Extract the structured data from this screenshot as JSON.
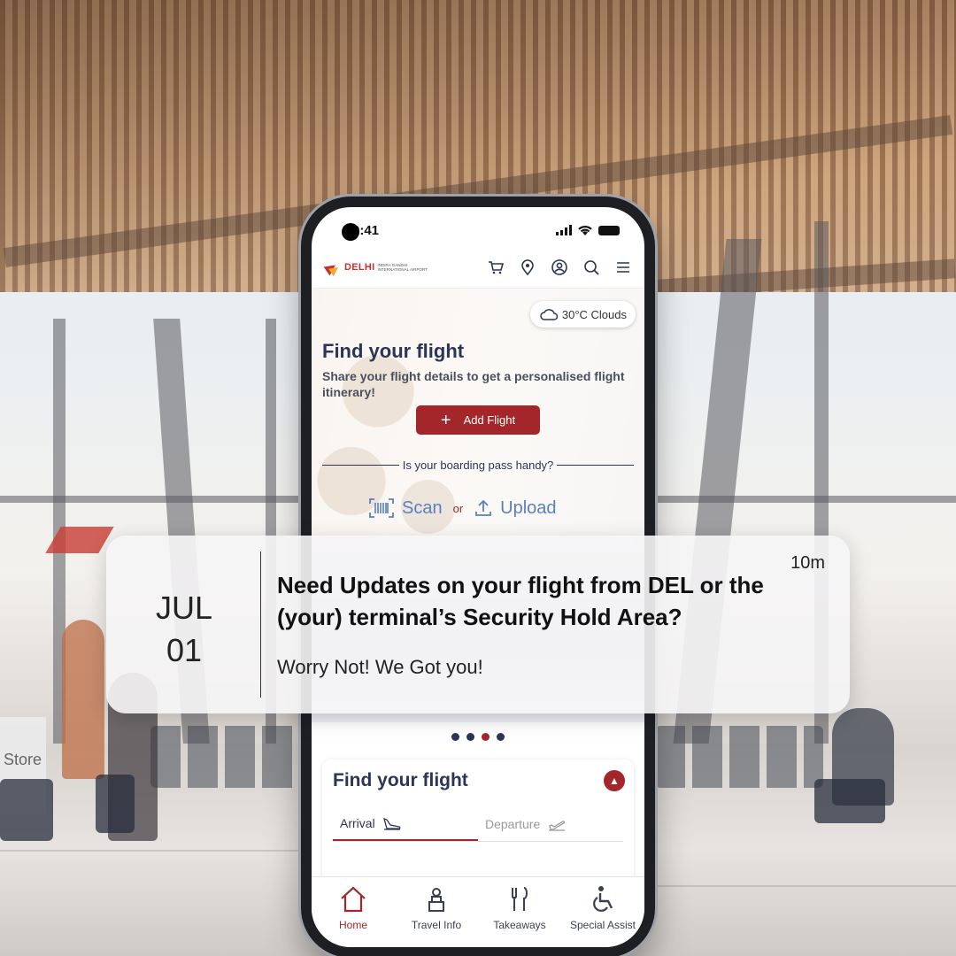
{
  "status_bar": {
    "time": "9:41"
  },
  "app": {
    "logo": {
      "word": "DELHI",
      "sub": "Indira Gandhi International Airport"
    },
    "header_icons": [
      "cart-icon",
      "location-icon",
      "profile-icon",
      "search-icon",
      "menu-icon"
    ],
    "weather": {
      "text": "30°C Clouds",
      "icon": "cloud-icon"
    },
    "hero": {
      "title": "Find your flight",
      "subtitle": "Share your flight details to get a personalised flight itinerary!",
      "add_button": "Add Flight",
      "divider_text": "Is your boarding pass handy?",
      "scan_label": "Scan",
      "or_label": "or",
      "upload_label": "Upload"
    },
    "carousel": {
      "dot_count": 4,
      "active_index": 2
    },
    "find_card": {
      "title": "Find your flight",
      "tabs": [
        {
          "label": "Arrival",
          "icon": "arrival-plane-icon",
          "active": true
        },
        {
          "label": "Departure",
          "icon": "departure-plane-icon",
          "active": false
        }
      ]
    },
    "bottom_nav": [
      {
        "label": "Home",
        "icon": "home-icon",
        "active": true
      },
      {
        "label": "Travel Info",
        "icon": "travel-info-icon",
        "active": false
      },
      {
        "label": "Takeaways",
        "icon": "takeaways-icon",
        "active": false
      },
      {
        "label": "Special Assist",
        "icon": "accessibility-icon",
        "active": false
      }
    ]
  },
  "notification": {
    "month": "JUL",
    "day": "01",
    "title": "Need Updates on your flight from DEL or the (your) terminal’s Security Hold Area?",
    "body": "Worry Not! We Got you!",
    "time": "10m"
  },
  "background": {
    "store_sign": "Store"
  },
  "colors": {
    "brand_red": "#a3262a",
    "navy": "#2b3557",
    "link_blue": "#5a7fc0"
  }
}
